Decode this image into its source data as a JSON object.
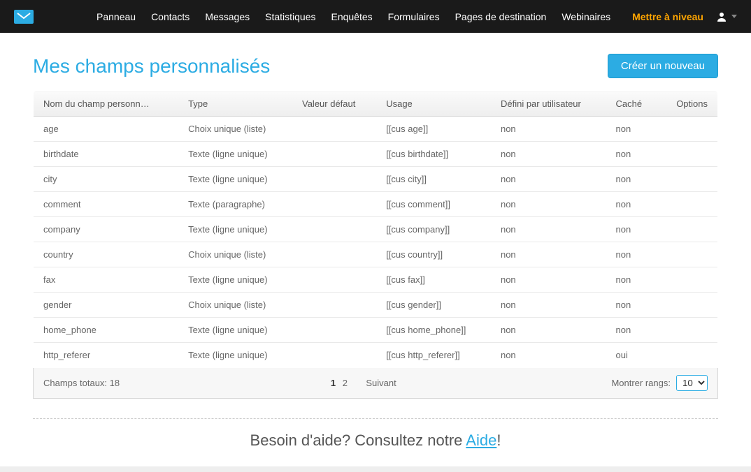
{
  "nav": {
    "items": [
      "Panneau",
      "Contacts",
      "Messages",
      "Statistiques",
      "Enquêtes",
      "Formulaires",
      "Pages de destination",
      "Webinaires"
    ],
    "upgrade": "Mettre à niveau"
  },
  "page": {
    "title": "Mes champs personnalisés",
    "create_button": "Créer un nouveau"
  },
  "table": {
    "headers": {
      "name": "Nom du champ personn…",
      "type": "Type",
      "default": "Valeur défaut",
      "usage": "Usage",
      "user_defined": "Défini par utilisateur",
      "hidden": "Caché",
      "options": "Options"
    },
    "rows": [
      {
        "name": "age",
        "type": "Choix unique (liste)",
        "default": "",
        "usage": "[[cus age]]",
        "user_defined": "non",
        "hidden": "non"
      },
      {
        "name": "birthdate",
        "type": "Texte (ligne unique)",
        "default": "",
        "usage": "[[cus birthdate]]",
        "user_defined": "non",
        "hidden": "non"
      },
      {
        "name": "city",
        "type": "Texte (ligne unique)",
        "default": "",
        "usage": "[[cus city]]",
        "user_defined": "non",
        "hidden": "non"
      },
      {
        "name": "comment",
        "type": "Texte (paragraphe)",
        "default": "",
        "usage": "[[cus comment]]",
        "user_defined": "non",
        "hidden": "non"
      },
      {
        "name": "company",
        "type": "Texte (ligne unique)",
        "default": "",
        "usage": "[[cus company]]",
        "user_defined": "non",
        "hidden": "non"
      },
      {
        "name": "country",
        "type": "Choix unique (liste)",
        "default": "",
        "usage": "[[cus country]]",
        "user_defined": "non",
        "hidden": "non"
      },
      {
        "name": "fax",
        "type": "Texte (ligne unique)",
        "default": "",
        "usage": "[[cus fax]]",
        "user_defined": "non",
        "hidden": "non"
      },
      {
        "name": "gender",
        "type": "Choix unique (liste)",
        "default": "",
        "usage": "[[cus gender]]",
        "user_defined": "non",
        "hidden": "non"
      },
      {
        "name": "home_phone",
        "type": "Texte (ligne unique)",
        "default": "",
        "usage": "[[cus home_phone]]",
        "user_defined": "non",
        "hidden": "non"
      },
      {
        "name": "http_referer",
        "type": "Texte (ligne unique)",
        "default": "",
        "usage": "[[cus http_referer]]",
        "user_defined": "non",
        "hidden": "oui"
      }
    ]
  },
  "footer": {
    "total_label": "Champs totaux: 18",
    "page_current": "1",
    "page_other": "2",
    "next": "Suivant",
    "show_rows_label": "Montrer rangs:",
    "show_rows_value": "10"
  },
  "help": {
    "prefix": "Besoin d'aide? Consultez notre ",
    "link": "Aide",
    "suffix": "!"
  }
}
